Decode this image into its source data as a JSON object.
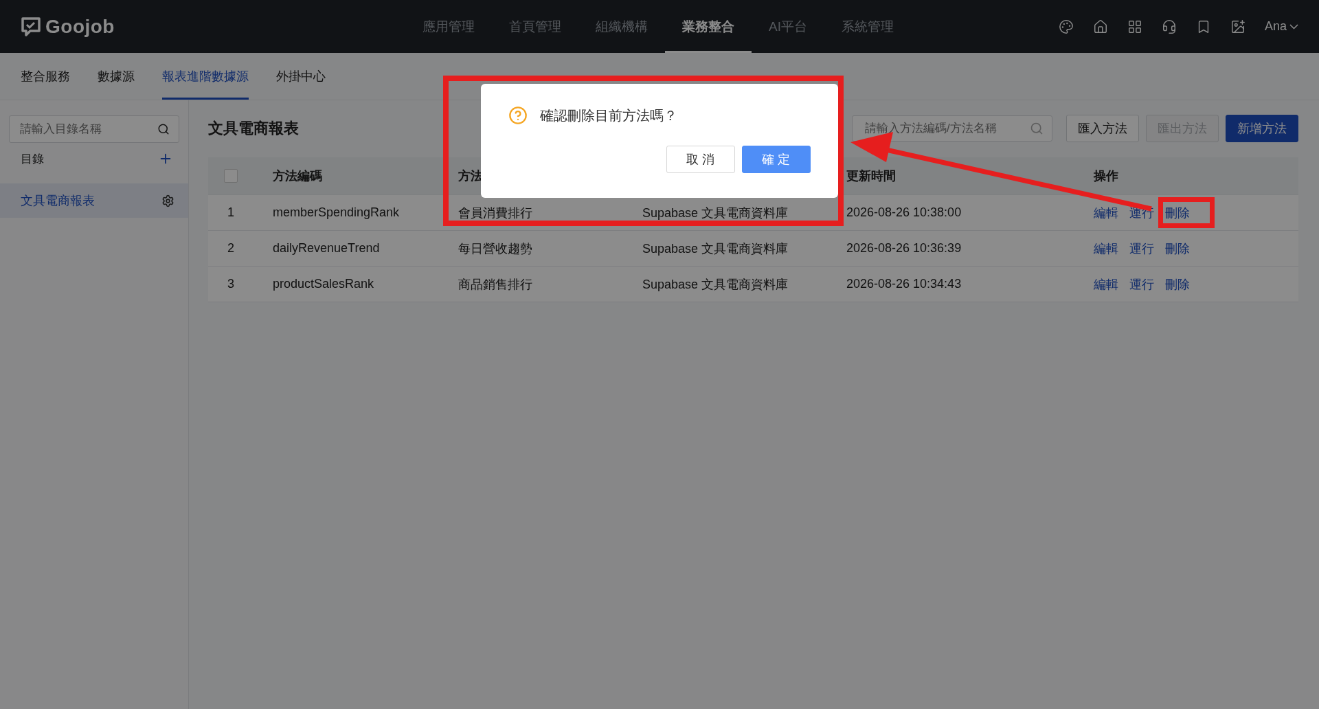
{
  "header": {
    "logo": "Goojob",
    "nav": [
      {
        "label": "應用管理",
        "selected": false
      },
      {
        "label": "首頁管理",
        "selected": false
      },
      {
        "label": "組織機構",
        "selected": false
      },
      {
        "label": "業務整合",
        "selected": true
      },
      {
        "label": "AI平台",
        "selected": false
      },
      {
        "label": "系統管理",
        "selected": false
      }
    ],
    "user": "Ana"
  },
  "subtabs": [
    {
      "label": "整合服務",
      "selected": false
    },
    {
      "label": "數據源",
      "selected": false
    },
    {
      "label": "報表進階數據源",
      "selected": true
    },
    {
      "label": "外掛中心",
      "selected": false
    }
  ],
  "sidebar": {
    "search_placeholder": "請輸入目錄名稱",
    "catalog_label": "目錄",
    "items": [
      {
        "label": "文具電商報表",
        "selected": true
      }
    ]
  },
  "main": {
    "title": "文具電商報表",
    "search_placeholder": "請輸入方法編碼/方法名稱",
    "buttons": [
      {
        "label": "匯入方法",
        "kind": "default"
      },
      {
        "label": "匯出方法",
        "kind": "disabled"
      },
      {
        "label": "新增方法",
        "kind": "primary"
      }
    ]
  },
  "table": {
    "select_all_checked": false,
    "columns": {
      "code": "方法編碼",
      "name": "方法",
      "updated": "更新時間",
      "actions": "操作"
    },
    "rows": [
      {
        "index": "1",
        "code": "memberSpendingRank",
        "name": "會員消費排行",
        "source": "Supabase 文具電商資料庫",
        "updated": "2026-08-26 10:38:00",
        "actions": [
          "編輯",
          "運行",
          "刪除"
        ]
      },
      {
        "index": "2",
        "code": "dailyRevenueTrend",
        "name": "每日營收趨勢",
        "source": "Supabase 文具電商資料庫",
        "updated": "2026-08-26 10:36:39",
        "actions": [
          "編輯",
          "運行",
          "刪除"
        ]
      },
      {
        "index": "3",
        "code": "productSalesRank",
        "name": "商品銷售排行",
        "source": "Supabase 文具電商資料庫",
        "updated": "2026-08-26 10:34:43",
        "actions": [
          "編輯",
          "運行",
          "刪除"
        ]
      }
    ]
  },
  "dialog": {
    "message": "確認刪除目前方法嗎？",
    "buttons": [
      {
        "label": "取 消",
        "kind": "default"
      },
      {
        "label": "確 定",
        "kind": "primary"
      }
    ]
  }
}
